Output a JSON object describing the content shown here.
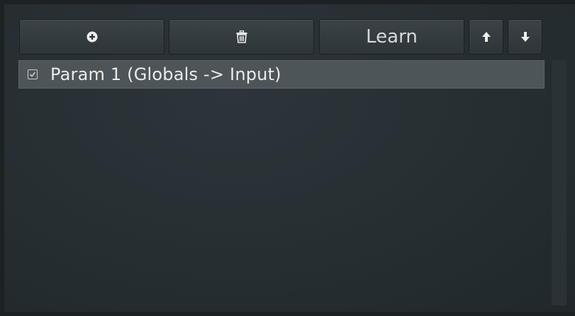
{
  "toolbar": {
    "add_icon": "plus-circle-icon",
    "delete_icon": "trash-icon",
    "learn_label": "Learn",
    "up_icon": "arrow-up-icon",
    "down_icon": "arrow-down-icon"
  },
  "list": {
    "items": [
      {
        "label": "Param 1 (Globals -> Input)",
        "checked": true,
        "selected": true
      }
    ]
  },
  "colors": {
    "background": "#262e32",
    "button": "#353c40",
    "selected_row": "#4e5558",
    "text": "#e9ecec"
  }
}
